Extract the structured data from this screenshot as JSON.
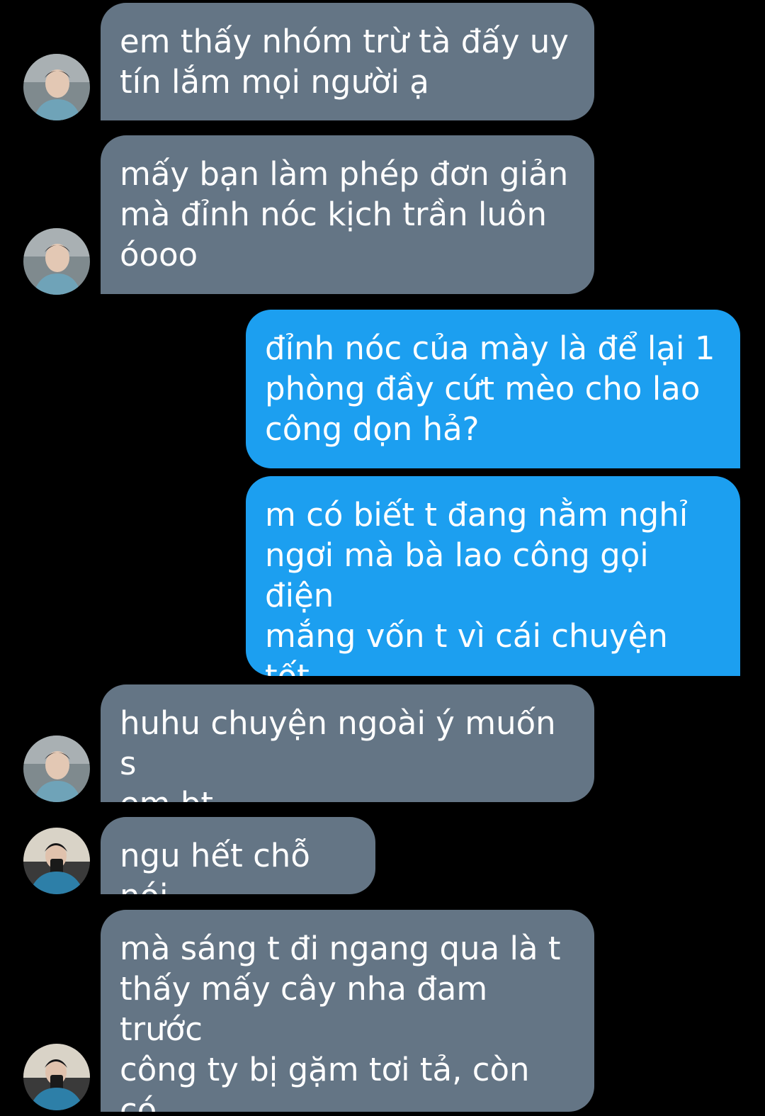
{
  "colors": {
    "background": "#000000",
    "incoming_bubble": "#647585",
    "outgoing_bubble": "#1c9ff0",
    "text": "#ffffff"
  },
  "messages": [
    {
      "direction": "incoming",
      "sender_avatar": "avatar-a",
      "text": "em thấy nhóm trừ tà đấy uy\ntín lắm mọi người ạ"
    },
    {
      "direction": "incoming",
      "sender_avatar": "avatar-a",
      "text": "mấy bạn làm phép đơn giản\nmà đỉnh nóc kịch trần luôn\nóooo"
    },
    {
      "direction": "outgoing",
      "text": "đỉnh nóc của mày là để lại 1\nphòng đầy cứt mèo cho lao\ncông dọn hả?"
    },
    {
      "direction": "outgoing",
      "text": "m có biết t đang nằm nghỉ\nngơi mà bà lao công gọi điện\nmắng vốn t vì cái chuyện tốt\nm gây ra ko=))))"
    },
    {
      "direction": "incoming",
      "sender_avatar": "avatar-a",
      "text": "huhu chuyện ngoài ý muốn s\nem bt"
    },
    {
      "direction": "incoming",
      "sender_avatar": "avatar-b",
      "text": "ngu hết chỗ nói"
    },
    {
      "direction": "incoming",
      "sender_avatar": "avatar-b",
      "text": "mà sáng t đi ngang qua là t\nthấy mấy cây nha đam trước\ncông ty bị gặm tơi tả, còn có\ndấu răng rõ ràng"
    }
  ]
}
